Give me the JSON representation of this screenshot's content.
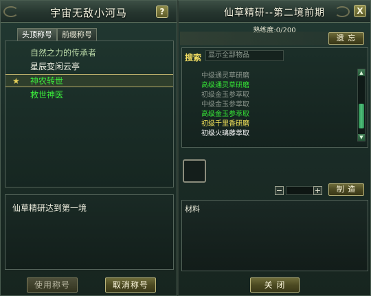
{
  "left": {
    "title": "宇宙无敌小河马",
    "help_icon": "?",
    "tabs": [
      {
        "label": "头顶称号",
        "active": true
      },
      {
        "label": "前缀称号",
        "active": false
      }
    ],
    "titles": [
      {
        "text": "自然之力的传承者",
        "color": "#b9d7a6"
      },
      {
        "text": "星辰变闲云亭",
        "color": "#f2f2e6"
      },
      {
        "text": "神农转世",
        "color": "#3cf23c",
        "selected": true
      },
      {
        "text": "救世神医",
        "color": "#3cf23c"
      }
    ],
    "description": "仙草精研达到第一境",
    "buttons": {
      "use": "使用称号",
      "cancel": "取消称号"
    }
  },
  "right": {
    "title": "仙草精研--第二境前期",
    "close_icon": "X",
    "proficiency": "熟练度:0/200",
    "forget_button": "遗  忘",
    "search_label": "搜索",
    "search_placeholder": "显示全部物品",
    "recipes": [
      {
        "text": "中级通灵草研磨",
        "color": "#8b958c"
      },
      {
        "text": "高级通灵草研磨",
        "color": "#36e836"
      },
      {
        "text": "初级金玉参萃取",
        "color": "#8b958c"
      },
      {
        "text": "中级金玉参萃取",
        "color": "#8b958c"
      },
      {
        "text": "高级金玉参萃取",
        "color": "#36e836"
      },
      {
        "text": "初级千里香研磨",
        "color": "#f3e35a"
      },
      {
        "text": "初级火璃藤萃取",
        "color": "#ffffff"
      }
    ],
    "qty_minus": "−",
    "qty_plus": "+",
    "make_button": "制  造",
    "materials_label": "材料",
    "close_button": "关  闭"
  },
  "colors": {
    "panel_bg": "#1b2d28",
    "gold_border": "#b9b37a",
    "green_text": "#3cf23c",
    "yellow_text": "#f2dd62"
  }
}
